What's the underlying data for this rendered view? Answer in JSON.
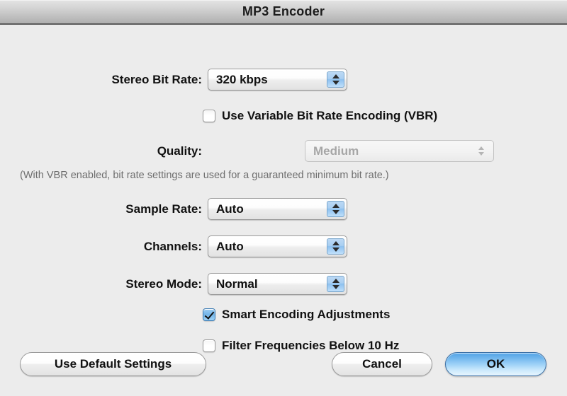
{
  "window": {
    "title": "MP3 Encoder"
  },
  "form": {
    "stereo_bit_rate": {
      "label": "Stereo Bit Rate:",
      "value": "320 kbps"
    },
    "vbr": {
      "label": "Use Variable Bit Rate Encoding (VBR)",
      "checked": false
    },
    "quality": {
      "label": "Quality:",
      "value": "Medium",
      "enabled": false
    },
    "vbr_hint": "(With VBR enabled, bit rate settings are used for a guaranteed minimum bit rate.)",
    "sample_rate": {
      "label": "Sample Rate:",
      "value": "Auto"
    },
    "channels": {
      "label": "Channels:",
      "value": "Auto"
    },
    "stereo_mode": {
      "label": "Stereo Mode:",
      "value": "Normal"
    },
    "smart_encoding": {
      "label": "Smart Encoding Adjustments",
      "checked": true
    },
    "filter_frequencies": {
      "label": "Filter Frequencies Below 10 Hz",
      "checked": false
    }
  },
  "buttons": {
    "use_default_settings": "Use Default Settings",
    "cancel": "Cancel",
    "ok": "OK"
  },
  "icons": {
    "stepper_up": "stepper-up-arrow-icon",
    "stepper_down": "stepper-down-arrow-icon",
    "checkmark": "checkmark-icon"
  },
  "colors": {
    "accent_blue": "#5aa8e8",
    "stepper_blue": "#a9cff2",
    "window_bg": "#ececec",
    "titlebar_top": "#e4e4e4",
    "titlebar_bottom": "#b0b0b0",
    "hint_gray": "#6e6e6e",
    "disabled_gray": "#a6a6a6"
  }
}
